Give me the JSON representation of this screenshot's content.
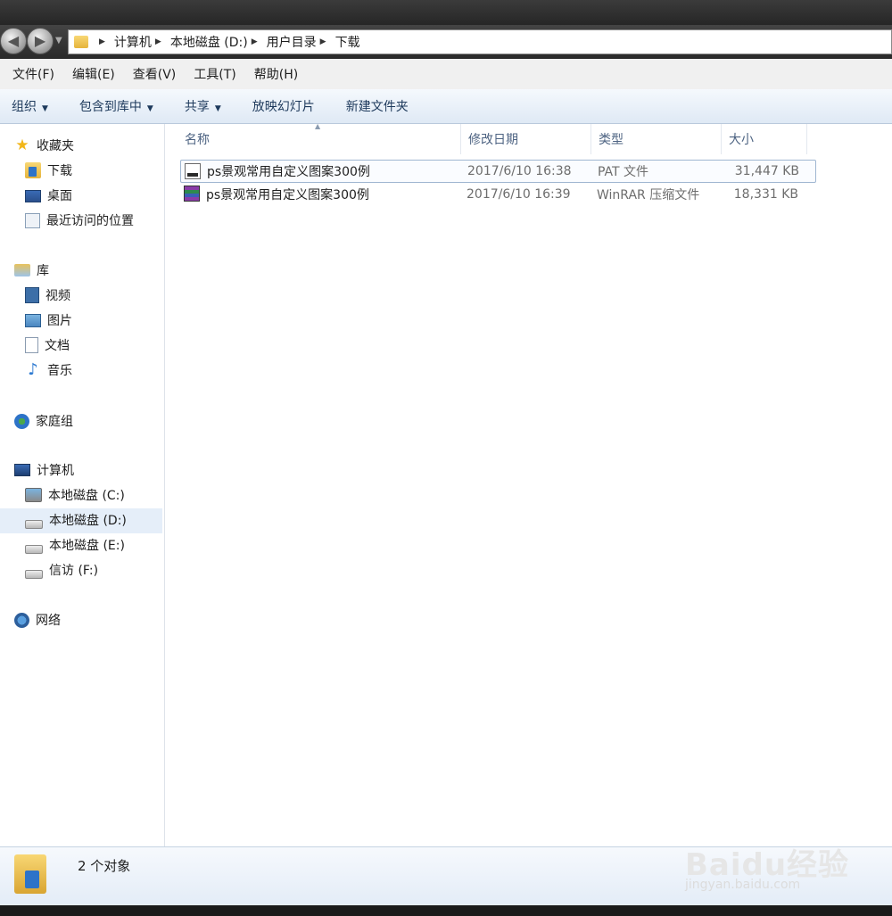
{
  "address": {
    "crumbs": [
      "计算机",
      "本地磁盘 (D:)",
      "用户目录",
      "下载"
    ]
  },
  "menu": [
    "文件(F)",
    "编辑(E)",
    "查看(V)",
    "工具(T)",
    "帮助(H)"
  ],
  "toolbar": {
    "organize": "组织",
    "include_library": "包含到库中",
    "share": "共享",
    "slideshow": "放映幻灯片",
    "new_folder": "新建文件夹"
  },
  "sidebar": {
    "favorites": {
      "label": "收藏夹",
      "items": [
        "下载",
        "桌面",
        "最近访问的位置"
      ]
    },
    "libraries": {
      "label": "库",
      "items": [
        "视频",
        "图片",
        "文档",
        "音乐"
      ]
    },
    "homegroup": {
      "label": "家庭组"
    },
    "computer": {
      "label": "计算机",
      "items": [
        "本地磁盘 (C:)",
        "本地磁盘 (D:)",
        "本地磁盘 (E:)",
        "信访 (F:)"
      ],
      "selected": "本地磁盘 (D:)"
    },
    "network": {
      "label": "网络"
    }
  },
  "columns": [
    "名称",
    "修改日期",
    "类型",
    "大小"
  ],
  "files": [
    {
      "name": "ps景观常用自定义图案300例",
      "date": "2017/6/10 16:38",
      "type": "PAT 文件",
      "size": "31,447 KB",
      "icon": "pat-file-icon",
      "selected": true
    },
    {
      "name": "ps景观常用自定义图案300例",
      "date": "2017/6/10 16:39",
      "type": "WinRAR 压缩文件",
      "size": "18,331 KB",
      "icon": "winrar-archive-icon",
      "selected": false
    }
  ],
  "status": {
    "text": "2 个对象"
  },
  "watermark": {
    "logo": "Baidu经验",
    "url": "jingyan.baidu.com"
  }
}
